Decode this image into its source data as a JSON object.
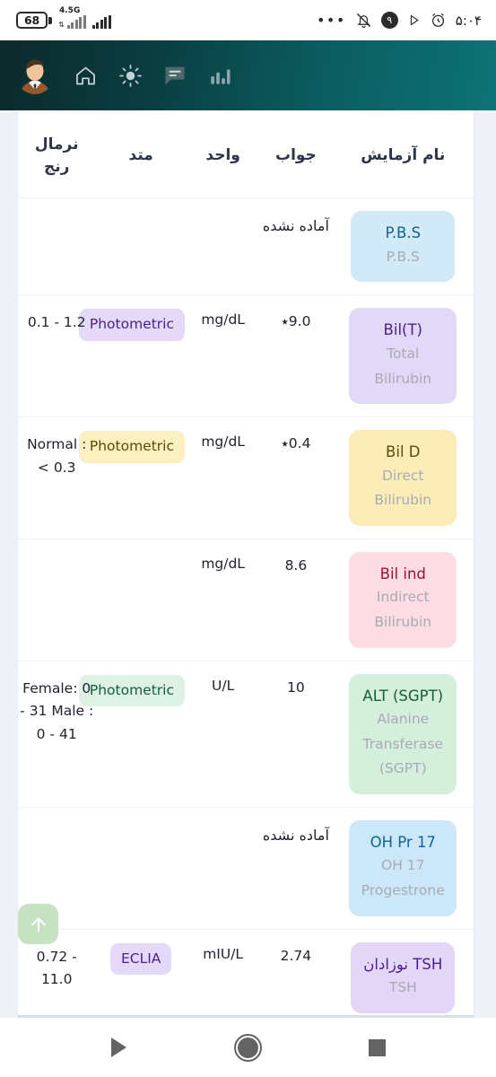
{
  "statusbar": {
    "battery_level": "68",
    "network_label": "4.5G",
    "notification_count": "۹",
    "time": "۵:۰۴",
    "icons": [
      "more-dots-icon",
      "muted-bell-icon",
      "notification-count-badge",
      "play-icon",
      "alarm-clock-icon"
    ]
  },
  "appbar": {
    "icons": [
      "avatar",
      "home-icon",
      "brightness-icon",
      "chat-icon",
      "chart-icon"
    ]
  },
  "table": {
    "headers": {
      "name": "نام آزمایش",
      "result": "جواب",
      "unit": "واحد",
      "method": "متد",
      "range": "نرمال رنج"
    },
    "rows": [
      {
        "abbr": "P.B.S",
        "full": "P.B.S",
        "result": "آماده نشده",
        "result_is_persian": true,
        "unit": "",
        "method": "",
        "range": "",
        "chip_bg": "#d2e9f7",
        "chip_fg": "#14638f",
        "method_bg": "",
        "method_fg": ""
      },
      {
        "abbr": "Bil(T)",
        "full": "Total Bilirubin",
        "result": "9.0٭",
        "result_is_persian": false,
        "unit": "mg/dL",
        "method": "Photometric",
        "range": "0.1 - 1.2",
        "chip_bg": "#e2d8f7",
        "chip_fg": "#4a1f8f",
        "method_bg": "#e4daf8",
        "method_fg": "#4a1f8f"
      },
      {
        "abbr": "Bil D",
        "full": "Direct Bilirubin",
        "result": "0.4٭",
        "result_is_persian": false,
        "unit": "mg/dL",
        "method": "Photometric",
        "range": "Normal : < 0.3",
        "chip_bg": "#fbecb8",
        "chip_fg": "#5d4a07",
        "method_bg": "#fcefc0",
        "method_fg": "#5d4a07"
      },
      {
        "abbr": "Bil ind",
        "full": "Indirect Bilirubin",
        "result": "8.6",
        "result_is_persian": false,
        "unit": "mg/dL",
        "method": "",
        "range": "",
        "chip_bg": "#fbdde3",
        "chip_fg": "#9e1236",
        "method_bg": "",
        "method_fg": ""
      },
      {
        "abbr": "ALT (SGPT)",
        "full": "Alanine Transferase (SGPT)",
        "result": "10",
        "result_is_persian": false,
        "unit": "U/L",
        "method": "Photometric",
        "range": "Female: 0 - 31 Male : 0 - 41",
        "chip_bg": "#d4efdc",
        "chip_fg": "#14603a",
        "method_bg": "#ddf2e4",
        "method_fg": "#14603a"
      },
      {
        "abbr": "17 OH Pr",
        "full": "17 OH Progestrone",
        "result": "آماده نشده",
        "result_is_persian": true,
        "unit": "",
        "method": "",
        "range": "",
        "chip_bg": "#cbe7f8",
        "chip_fg": "#14638f",
        "method_bg": "",
        "method_fg": ""
      },
      {
        "abbr": "TSH نوزادان",
        "full": "TSH",
        "result": "2.74",
        "result_is_persian": false,
        "unit": "mIU/L",
        "method": "ECLIA",
        "range": "0.72 - 11.0",
        "chip_bg": "#e3d6f7",
        "chip_fg": "#4a1f8f",
        "method_bg": "#e4daf8",
        "method_fg": "#4a1f8f"
      }
    ]
  },
  "fab": {
    "name": "scroll-to-top-button",
    "bg": "#c7e2c2"
  },
  "navbar": {
    "items": [
      "back-button",
      "home-button",
      "recents-button"
    ]
  }
}
